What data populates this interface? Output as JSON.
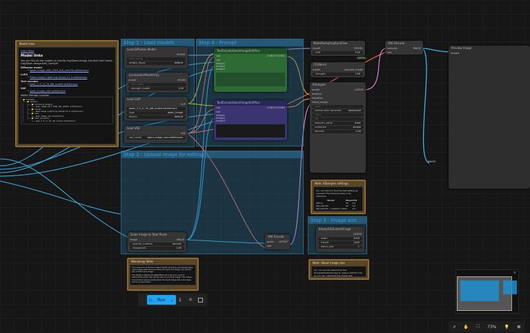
{
  "colors": {
    "model": "#b39ddb",
    "clip": "#ffd500",
    "vae": "#ff6e6e",
    "image": "#64b5f6",
    "conditioning": "#ffa931",
    "latent": "#ff9cf9",
    "group": "#3a8fc0",
    "note": "#8a6a35"
  },
  "groups": {
    "step1": "Step 1 - Load models",
    "step4": "Step 4 - Prompt",
    "step2": "Step 2 - Upload image for editing",
    "step3": "Step 3 - Image size"
  },
  "model_links": {
    "title": "Model links",
    "tag": "Learn More",
    "heading": "Model links",
    "intro": "You can find all the models on Comfy-Org/Qwen-Image_ComfyUI and Comfy-Org/Qwen-Image-Edit_ComfyUI",
    "sections": [
      {
        "label": "Diffusion model",
        "link": "qwen_image_edit_2509_fp8_e4m3fn.safetensors"
      },
      {
        "label": "LoRA",
        "link": "Qwen-Image-Lightning-4steps-V1.0.safetensors"
      },
      {
        "label": "Text encoder",
        "link": "qwen_2.5_vl_7b_fp8_scaled.safetensors"
      },
      {
        "label": "VAE",
        "link": "qwen_image_vae.safetensors"
      }
    ],
    "storage_label": "Model Storage Location",
    "tree": [
      "📂 ComfyUI/",
      "├── 📂 models/",
      "│   ├── 📂 diffusion_models/",
      "│   │   └── qwen_image_edit_2509_fp8_e4m3fn.safetensors",
      "│   ├── 📂 loras/",
      "│   │   └── Qwen-Image-Lightning-4steps-V1.0.safetensors",
      "│   ├── 📂 vae/",
      "│   │   └── qwen_image_vae.safetensors",
      "│   └── 📂 text_encoders/",
      "│       └── qwen_2.5_vl_7b_fp8_scaled.safetensors"
    ]
  },
  "nodes": {
    "load_diffusion": {
      "title": "Load Diffusion Model",
      "out": "MODEL",
      "unet_name": "unet_name",
      "weight_dtype": "weight_dtype",
      "weight_dtype_val": "default"
    },
    "lora": {
      "title": "LoraLoaderModelOnly",
      "in": "model",
      "out": "MODEL",
      "lora_name": "lora_name",
      "strength": "strength_model",
      "strength_val": "1.00"
    },
    "load_clip": {
      "title": "Load CLIP",
      "out": "CLIP",
      "clip_name_val": "qwen_2.5_vl_7b_fp8_scaled.safetensors",
      "type": "type",
      "type_val": "qwen_image",
      "device": "device",
      "device_val": "default"
    },
    "load_vae": {
      "title": "Load VAE",
      "out": "VAE",
      "vae_name": "vae_name",
      "vae_name_val": "qwen_image_vae.safetensors"
    },
    "enc_pos": {
      "title": "TextEncodeQwenImageEditPlus",
      "inputs": [
        "clip",
        "vae",
        "image1",
        "image2",
        "image3"
      ],
      "out": "CONDITIONING"
    },
    "enc_neg": {
      "title": "TextEncodeQwenImageEditPlus",
      "inputs": [
        "clip",
        "vae",
        "image1",
        "image2",
        "image3"
      ],
      "out": "CONDITIONING"
    },
    "aura": {
      "title": "ModelSamplingAuraFlow",
      "in": "model",
      "out": "MODEL",
      "shift": "shift",
      "shift_val": "3.00",
      "badge": "(BETA)"
    },
    "cfgnorm": {
      "title": "CFGNorm",
      "in": "model",
      "out": "patched_model",
      "strength": "strength",
      "strength_val": "1.00"
    },
    "ksampler": {
      "title": "KSampler",
      "inputs": [
        "model",
        "positive",
        "negative",
        "latent_image"
      ],
      "out": "LATENT",
      "seed": "seed",
      "control": "control after generate",
      "control_val": "randomize",
      "steps": "steps",
      "cfg": "cfg",
      "sampler": "sampler_name",
      "sampler_val": "euler",
      "scheduler": "scheduler",
      "scheduler_val": "simple",
      "denoise": "denoise",
      "denoise_val": "1.00"
    },
    "vae_decode": {
      "title": "VAE Decode",
      "inputs": [
        "samples",
        "vae"
      ],
      "out": "IMAGE"
    },
    "preview": {
      "title": "Preview Image",
      "in": "images"
    },
    "scale": {
      "title": "Scale Image to Total Pixels",
      "in": "image",
      "out": "IMAGE",
      "method": "upscale_method",
      "method_val": "lanczos",
      "mp": "megapixels",
      "mp_val": "1.00"
    },
    "vae_encode": {
      "title": "VAE Encode",
      "inputs": [
        "pixels",
        "vae"
      ],
      "out": "LATENT"
    },
    "latent": {
      "title": "EmptySD3LatentImage",
      "out": "LATENT",
      "width": "width",
      "width_val": "1040",
      "height": "height",
      "height_val": "1440",
      "batch": "batch_size",
      "batch_val": "1"
    },
    "reroute": {
      "out": "IMAGE"
    }
  },
  "notes": {
    "ksampler": {
      "title": "Note: KSampler settings",
      "text": "You can test and find the best setting by yourself. The following table is for reference.",
      "headers": [
        "Model",
        "Steps",
        "CFG"
      ],
      "rows": [
        [
          "Offical",
          "50",
          "4.0"
        ],
        [
          "fp8_e4m3fn",
          "20",
          "2.5"
        ],
        [
          "fp8_e4m3fn + lightx2v LoRA",
          "4",
          "1.0"
        ]
      ]
    },
    "image_size": {
      "title": "Note: About image size",
      "text": "You can use the latent from the EmptySD3LatentImage to replace VAE Encode, so you can customize the image size."
    },
    "unknown": {
      "title": "Wanxiang: Note",
      "text1": "This node is to avoid bad output results caused by excessively large input image sizes. Because when we input one image, we use the size of that input image.",
      "text2": "The TextEncodeQwenImageEditPlus will scale your input to 1024×1024 pixels. We use the size of your first image. This node is to avoid bad output results when the input image size is too large and it is scaled down."
    }
  },
  "toolbar": {
    "run": "Run",
    "count": "1"
  },
  "footer": {
    "zoom": "73%"
  }
}
